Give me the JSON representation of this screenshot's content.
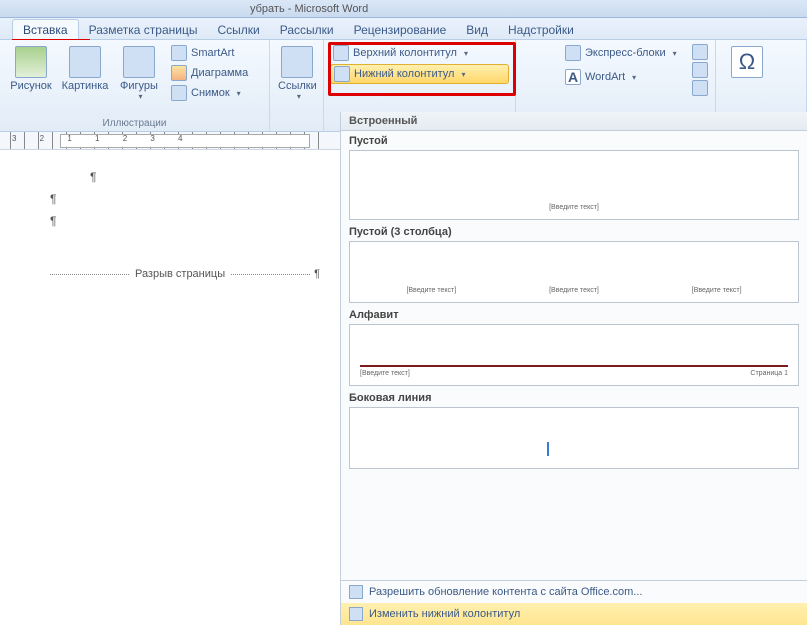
{
  "window": {
    "title": "убрать - Microsoft Word"
  },
  "tabs": {
    "items": [
      "Вставка",
      "Разметка страницы",
      "Ссылки",
      "Рассылки",
      "Рецензирование",
      "Вид",
      "Надстройки"
    ],
    "active": 0
  },
  "ribbon": {
    "illustrations": {
      "label": "Иллюстрации",
      "picture": "Рисунок",
      "clipart": "Картинка",
      "shapes": "Фигуры",
      "smartart": "SmartArt",
      "chart": "Диаграмма",
      "screenshot": "Снимок"
    },
    "links": {
      "label": "Ссылки"
    },
    "headerfooter": {
      "header": "Верхний колонтитул",
      "footer": "Нижний колонтитул"
    },
    "text": {
      "quickparts": "Экспресс-блоки",
      "wordart": "WordArt"
    },
    "symbols": {
      "label": "Символы"
    }
  },
  "ruler": {
    "marks": "3 2 1   1 2 3 4"
  },
  "document": {
    "para1": "¶",
    "para2": "¶",
    "para3": "¶",
    "pagebreak": "Разрыв страницы",
    "pagebreak_mark": "¶"
  },
  "gallery": {
    "header": "Встроенный",
    "items": [
      {
        "title": "Пустой",
        "placeholders": [
          "[Введите текст]"
        ]
      },
      {
        "title": "Пустой (3 столбца)",
        "placeholders": [
          "[Введите текст]",
          "[Введите текст]",
          "[Введите текст]"
        ]
      },
      {
        "title": "Алфавит",
        "placeholders": [
          "[Введите текст]",
          "Страница 1"
        ],
        "redline": true
      },
      {
        "title": "Боковая линия",
        "cursor": true
      }
    ],
    "footer": {
      "office": "Разрешить обновление контента с сайта Office.com...",
      "edit": "Изменить нижний колонтитул"
    }
  }
}
